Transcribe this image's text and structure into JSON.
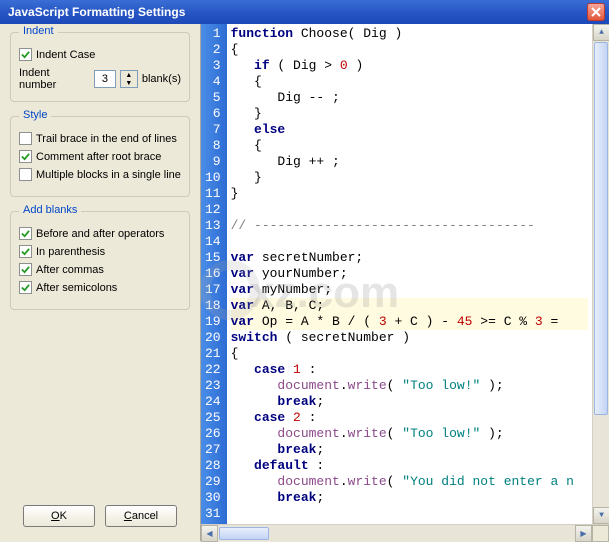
{
  "window": {
    "title": "JavaScript Formatting Settings"
  },
  "sidebar": {
    "groups": {
      "indent": {
        "legend": "Indent",
        "indent_case_label": "Indent Case",
        "indent_case_checked": true,
        "indent_number_label": "Indent number",
        "indent_number_value": "3",
        "blanks_label": "blank(s)"
      },
      "style": {
        "legend": "Style",
        "trail_brace_label": "Trail brace in the end of lines",
        "trail_brace_checked": false,
        "comment_label": "Comment after root brace",
        "comment_checked": true,
        "multiple_blocks_label": "Multiple blocks in a single line",
        "multiple_blocks_checked": false
      },
      "blanks": {
        "legend": "Add blanks",
        "operators_label": "Before and after operators",
        "operators_checked": true,
        "parenthesis_label": "In parenthesis",
        "parenthesis_checked": true,
        "commas_label": "After commas",
        "commas_checked": true,
        "semicolons_label": "After semicolons",
        "semicolons_checked": true
      }
    },
    "buttons": {
      "ok": "OK",
      "cancel": "Cancel"
    }
  },
  "code": {
    "lines": [
      {
        "n": 1,
        "html": "<span class='kw'>function</span> Choose( Dig )"
      },
      {
        "n": 2,
        "html": "{"
      },
      {
        "n": 3,
        "html": "   <span class='kw'>if</span> ( Dig &gt; <span class='num'>0</span> )"
      },
      {
        "n": 4,
        "html": "   {"
      },
      {
        "n": 5,
        "html": "      Dig -- ;"
      },
      {
        "n": 6,
        "html": "   }"
      },
      {
        "n": 7,
        "html": "   <span class='kw'>else</span>"
      },
      {
        "n": 8,
        "html": "   {"
      },
      {
        "n": 9,
        "html": "      Dig ++ ;"
      },
      {
        "n": 10,
        "html": "   }"
      },
      {
        "n": 11,
        "html": "}"
      },
      {
        "n": 12,
        "html": ""
      },
      {
        "n": 13,
        "html": "<span class='cmt'>// ------------------------------------</span>"
      },
      {
        "n": 14,
        "html": ""
      },
      {
        "n": 15,
        "html": "<span class='kw'>var</span> secretNumber;"
      },
      {
        "n": 16,
        "html": "<span class='kw'>var</span> yourNumber;"
      },
      {
        "n": 17,
        "html": "<span class='kw'>var</span> myNumber;"
      },
      {
        "n": 18,
        "html": "<span class='kw'>var</span> A, B, C;",
        "hl": true
      },
      {
        "n": 19,
        "html": "<span class='kw'>var</span> Op = A * B / ( <span class='num'>3</span> + C ) - <span class='num'>45</span> &gt;= C % <span class='num'>3</span> = ",
        "hl": true
      },
      {
        "n": 20,
        "html": "<span class='kw'>switch</span> ( secretNumber )"
      },
      {
        "n": 21,
        "html": "{"
      },
      {
        "n": 22,
        "html": "   <span class='kw'>case</span> <span class='num'>1</span> :"
      },
      {
        "n": 23,
        "html": "      <span class='fn'>document</span>.<span class='fn'>write</span>( <span class='str'>\"Too low!\"</span> );"
      },
      {
        "n": 24,
        "html": "      <span class='kw'>break</span>;"
      },
      {
        "n": 25,
        "html": "   <span class='kw'>case</span> <span class='num'>2</span> :"
      },
      {
        "n": 26,
        "html": "      <span class='fn'>document</span>.<span class='fn'>write</span>( <span class='str'>\"Too low!\"</span> );"
      },
      {
        "n": 27,
        "html": "      <span class='kw'>break</span>;"
      },
      {
        "n": 28,
        "html": "   <span class='kw'>default</span> :"
      },
      {
        "n": 29,
        "html": "      <span class='fn'>document</span>.<span class='fn'>write</span>( <span class='str'>\"You did not enter a n</span>"
      },
      {
        "n": 30,
        "html": "      <span class='kw'>break</span>;"
      },
      {
        "n": 31,
        "html": ""
      }
    ]
  },
  "watermark": "xz.com"
}
